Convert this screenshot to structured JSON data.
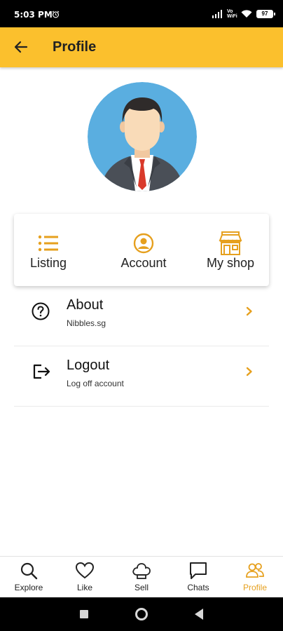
{
  "status_bar": {
    "time": "5:03 PM",
    "network_label": "Vo\nWiFi",
    "battery": "97"
  },
  "app_bar": {
    "title": "Profile",
    "back_icon": "arrow-left-icon"
  },
  "quick_actions": [
    {
      "label": "Listing",
      "icon": "list-icon"
    },
    {
      "label": "Account",
      "icon": "account-circle-icon"
    },
    {
      "label": "My shop",
      "icon": "storefront-icon"
    }
  ],
  "menu": [
    {
      "title": "About",
      "subtitle": "Nibbles.sg",
      "icon": "help-circle-icon"
    },
    {
      "title": "Logout",
      "subtitle": "Log off account",
      "icon": "logout-icon"
    }
  ],
  "bottom_nav": [
    {
      "label": "Explore",
      "icon": "search-icon",
      "active": false
    },
    {
      "label": "Like",
      "icon": "heart-icon",
      "active": false
    },
    {
      "label": "Sell",
      "icon": "chef-hat-icon",
      "active": false
    },
    {
      "label": "Chats",
      "icon": "chat-bubble-icon",
      "active": false
    },
    {
      "label": "Profile",
      "icon": "people-icon",
      "active": true
    }
  ],
  "colors": {
    "primary": "#fbc02d",
    "accent": "#e6a01e",
    "avatar_background": "#5aaee0"
  }
}
